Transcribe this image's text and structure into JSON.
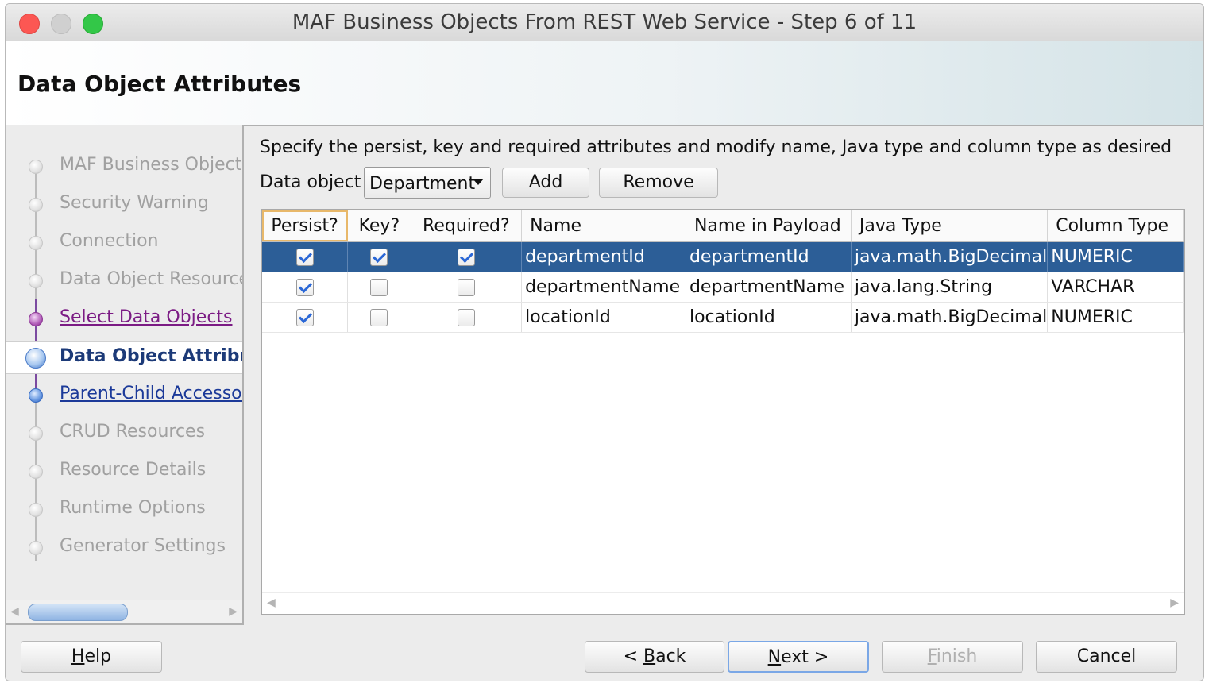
{
  "window": {
    "title": "MAF Business Objects From REST Web Service - Step 6 of 11"
  },
  "header": {
    "title": "Data Object Attributes"
  },
  "nav": {
    "items": [
      {
        "label": "MAF Business Objects",
        "state": "disabled"
      },
      {
        "label": "Security Warning",
        "state": "disabled"
      },
      {
        "label": "Connection",
        "state": "disabled"
      },
      {
        "label": "Data Object Resource",
        "state": "disabled"
      },
      {
        "label": "Select Data Objects",
        "state": "visited"
      },
      {
        "label": "Data Object Attribut",
        "state": "current"
      },
      {
        "label": "Parent-Child Accessor",
        "state": "link"
      },
      {
        "label": "CRUD Resources",
        "state": "disabled"
      },
      {
        "label": "Resource Details",
        "state": "disabled"
      },
      {
        "label": "Runtime Options",
        "state": "disabled"
      },
      {
        "label": "Generator Settings",
        "state": "disabled"
      }
    ]
  },
  "main": {
    "description": "Specify the persist, key and required attributes and modify name, Java type and column type as desired",
    "data_object_label": "Data object",
    "data_object_value": "Department",
    "add_label": "Add",
    "remove_label": "Remove"
  },
  "table": {
    "columns": [
      "Persist?",
      "Key?",
      "Required?",
      "Name",
      "Name in Payload",
      "Java Type",
      "Column Type"
    ],
    "rows": [
      {
        "persist": true,
        "key": true,
        "required": true,
        "name": "departmentId",
        "payload": "departmentId",
        "java_type": "java.math.BigDecimal",
        "column_type": "NUMERIC",
        "selected": true
      },
      {
        "persist": true,
        "key": false,
        "required": false,
        "name": "departmentName",
        "payload": "departmentName",
        "java_type": "java.lang.String",
        "column_type": "VARCHAR",
        "selected": false
      },
      {
        "persist": true,
        "key": false,
        "required": false,
        "name": "locationId",
        "payload": "locationId",
        "java_type": "java.math.BigDecimal",
        "column_type": "NUMERIC",
        "selected": false
      }
    ]
  },
  "footer": {
    "help": {
      "mnemonic": "H",
      "rest": "elp"
    },
    "back": {
      "prefix": "< ",
      "mnemonic": "B",
      "rest": "ack"
    },
    "next": {
      "mnemonic": "N",
      "rest": "ext >"
    },
    "finish": {
      "mnemonic": "F",
      "rest": "inish"
    },
    "cancel": {
      "label": "Cancel"
    }
  },
  "colors": {
    "selection": "#2c5e97",
    "visited_link": "#7b1b84",
    "current_step": "#1c3a78"
  }
}
